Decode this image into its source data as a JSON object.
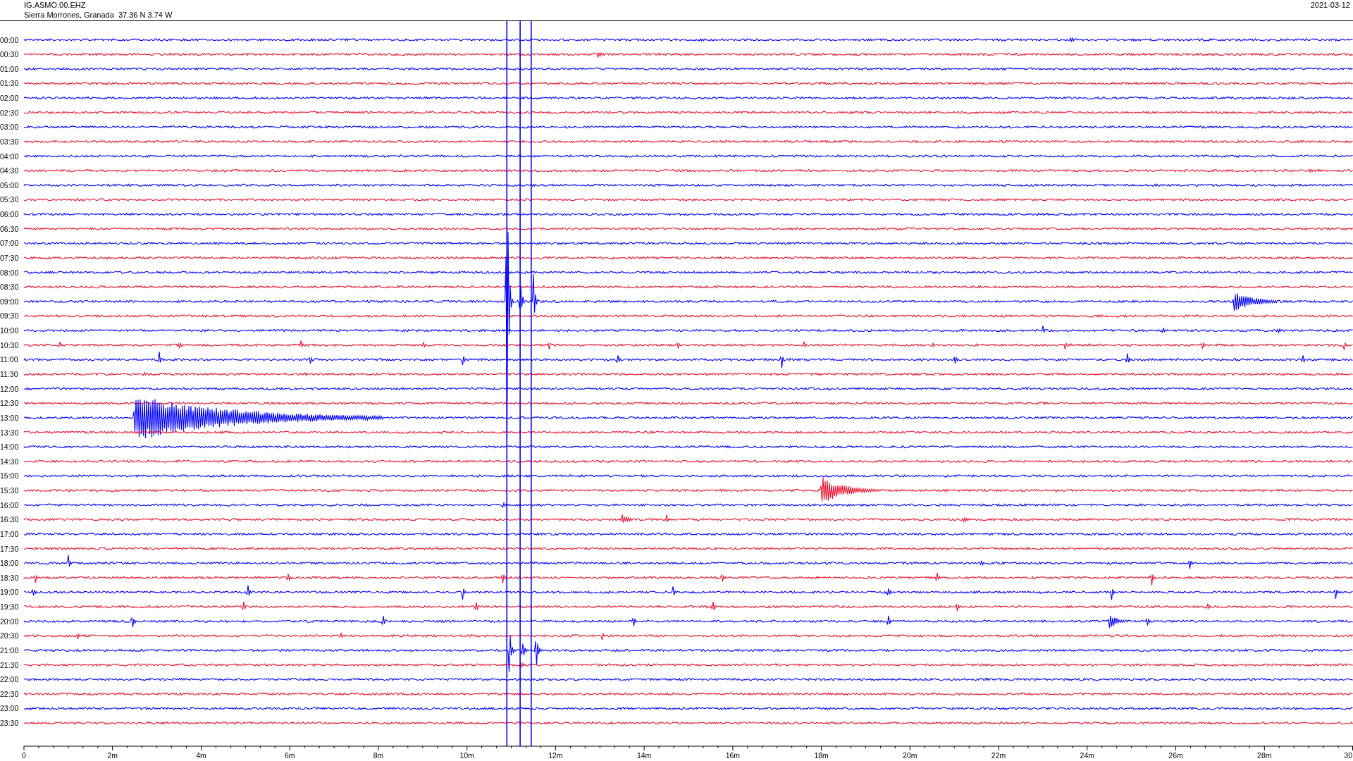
{
  "header": {
    "station": "IG.ASMO.00.EHZ",
    "location": "Sierra Morrones, Granada  37.36 N 3.74 W",
    "date": "2021-03-12"
  },
  "rows": [
    {
      "label": "00:00",
      "color": "#0000ff"
    },
    {
      "label": "00:30",
      "color": "#e8112d"
    },
    {
      "label": "01:00",
      "color": "#0000ff"
    },
    {
      "label": "01:30",
      "color": "#e8112d"
    },
    {
      "label": "02:00",
      "color": "#0000ff"
    },
    {
      "label": "02:30",
      "color": "#e8112d"
    },
    {
      "label": "03:00",
      "color": "#0000ff"
    },
    {
      "label": "03:30",
      "color": "#e8112d"
    },
    {
      "label": "04:00",
      "color": "#0000ff"
    },
    {
      "label": "04:30",
      "color": "#e8112d"
    },
    {
      "label": "05:00",
      "color": "#0000ff"
    },
    {
      "label": "05:30",
      "color": "#e8112d"
    },
    {
      "label": "06:00",
      "color": "#0000ff"
    },
    {
      "label": "06:30",
      "color": "#e8112d"
    },
    {
      "label": "07:00",
      "color": "#0000ff"
    },
    {
      "label": "07:30",
      "color": "#e8112d"
    },
    {
      "label": "08:00",
      "color": "#0000ff"
    },
    {
      "label": "08:30",
      "color": "#e8112d"
    },
    {
      "label": "09:00",
      "color": "#0000ff"
    },
    {
      "label": "09:30",
      "color": "#e8112d"
    },
    {
      "label": "10:00",
      "color": "#0000ff"
    },
    {
      "label": "10:30",
      "color": "#e8112d"
    },
    {
      "label": "11:00",
      "color": "#0000ff"
    },
    {
      "label": "11:30",
      "color": "#e8112d"
    },
    {
      "label": "12:00",
      "color": "#0000ff"
    },
    {
      "label": "12:30",
      "color": "#e8112d"
    },
    {
      "label": "13:00",
      "color": "#0000ff"
    },
    {
      "label": "13:30",
      "color": "#e8112d"
    },
    {
      "label": "14:00",
      "color": "#0000ff"
    },
    {
      "label": "14:30",
      "color": "#e8112d"
    },
    {
      "label": "15:00",
      "color": "#0000ff"
    },
    {
      "label": "15:30",
      "color": "#e8112d"
    },
    {
      "label": "16:00",
      "color": "#0000ff"
    },
    {
      "label": "16:30",
      "color": "#e8112d"
    },
    {
      "label": "17:00",
      "color": "#0000ff"
    },
    {
      "label": "17:30",
      "color": "#e8112d"
    },
    {
      "label": "18:00",
      "color": "#0000ff"
    },
    {
      "label": "18:30",
      "color": "#e8112d"
    },
    {
      "label": "19:00",
      "color": "#0000ff"
    },
    {
      "label": "19:30",
      "color": "#e8112d"
    },
    {
      "label": "20:00",
      "color": "#0000ff"
    },
    {
      "label": "20:30",
      "color": "#e8112d"
    },
    {
      "label": "21:00",
      "color": "#0000ff"
    },
    {
      "label": "21:30",
      "color": "#e8112d"
    },
    {
      "label": "22:00",
      "color": "#0000ff"
    },
    {
      "label": "22:30",
      "color": "#e8112d"
    },
    {
      "label": "23:00",
      "color": "#0000ff"
    },
    {
      "label": "23:30",
      "color": "#e8112d"
    }
  ],
  "x_axis": {
    "ticks": [
      "0",
      "2m",
      "4m",
      "6m",
      "8m",
      "10m",
      "12m",
      "14m",
      "16m",
      "18m",
      "20m",
      "22m",
      "24m",
      "26m",
      "28m",
      "30"
    ]
  }
}
